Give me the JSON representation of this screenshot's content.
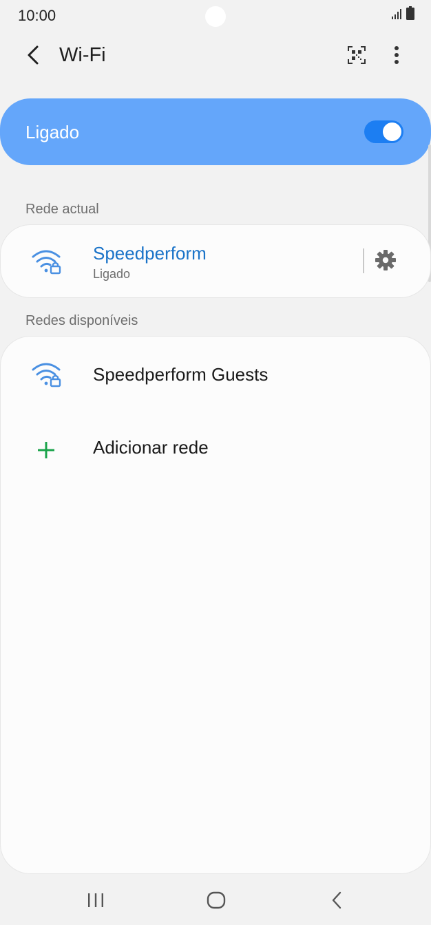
{
  "status_bar": {
    "time": "10:00",
    "signal_icon": "signal-bars-icon",
    "battery_icon": "battery-icon"
  },
  "app_bar": {
    "title": "Wi-Fi",
    "back_icon": "chevron-left-icon",
    "qr_icon": "qr-code-icon",
    "more_icon": "more-vertical-icon"
  },
  "master_switch": {
    "label": "Ligado",
    "state": "on"
  },
  "current_network": {
    "section_title": "Rede actual",
    "name": "Speedperform",
    "status": "Ligado",
    "icon": "wifi-lock-icon",
    "settings_icon": "gear-icon"
  },
  "available_networks": {
    "section_title": "Redes disponíveis",
    "items": [
      {
        "name": "Speedperform Guests",
        "icon": "wifi-lock-icon"
      }
    ],
    "add_network_label": "Adicionar rede",
    "add_icon": "plus-icon"
  },
  "nav_bar": {
    "recents_icon": "recents-icon",
    "home_icon": "home-icon",
    "back_icon": "back-icon"
  },
  "colors": {
    "accent": "#1c7ef2",
    "switch_bar": "#64a6fa",
    "connected_text": "#1a73c8",
    "wifi_icon": "#4a90e2",
    "add_icon": "#1aa34a",
    "background": "#f2f2f2"
  }
}
